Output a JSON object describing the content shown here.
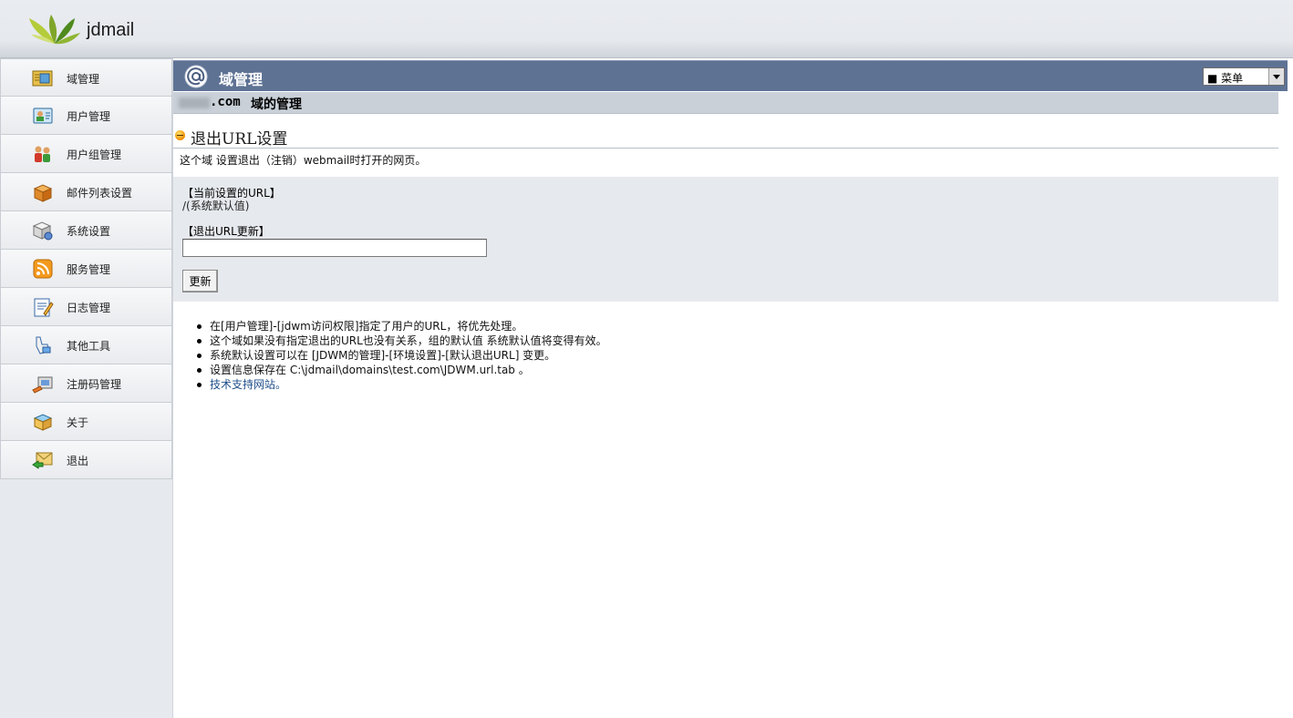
{
  "header": {
    "brand": "jdmail",
    "logo_icon": "leaf-logo-icon"
  },
  "sidebar": {
    "items": [
      {
        "label": "域管理",
        "icon": "domain-folder-icon"
      },
      {
        "label": "用户管理",
        "icon": "user-card-icon"
      },
      {
        "label": "用户组管理",
        "icon": "user-group-icon"
      },
      {
        "label": "邮件列表设置",
        "icon": "mail-list-box-icon"
      },
      {
        "label": "系统设置",
        "icon": "system-settings-icon"
      },
      {
        "label": "服务管理",
        "icon": "rss-service-icon"
      },
      {
        "label": "日志管理",
        "icon": "log-notepad-icon"
      },
      {
        "label": "其他工具",
        "icon": "tools-hand-icon"
      },
      {
        "label": "注册码管理",
        "icon": "license-key-icon"
      },
      {
        "label": "关于",
        "icon": "about-box-icon"
      },
      {
        "label": "退出",
        "icon": "logout-envelope-icon"
      }
    ]
  },
  "titlebar": {
    "title": "域管理",
    "icon": "at-sign-icon",
    "menu_selected": "■ 菜单"
  },
  "domain": {
    "suffix": ".com",
    "heading": "域的管理"
  },
  "section": {
    "title": "退出URL设置",
    "description": "这个域 设置退出（注销）webmail时打开的网页。"
  },
  "form": {
    "current_label": "【当前设置的URL】",
    "current_value": "/(系统默认值)",
    "update_label": "【退出URL更新】",
    "url_value": "",
    "update_button": "更新"
  },
  "notes": [
    "在[用户管理]-[jdwm访问权限]指定了用户的URL，将优先处理。",
    "这个域如果没有指定退出的URL也没有关系，组的默认值 系统默认值将变得有效。",
    "系统默认设置可以在 [JDWM的管理]-[环境设置]-[默认退出URL] 变更。",
    "设置信息保存在 C:\\jdmail\\domains\\test.com\\JDWM.url.tab 。"
  ],
  "support_link": "技术支持网站。",
  "colors": {
    "titlebar": "#5e7294",
    "sidebar": "#e6e9ed",
    "panel": "#e6e9ed",
    "link": "#1f4f8a"
  }
}
